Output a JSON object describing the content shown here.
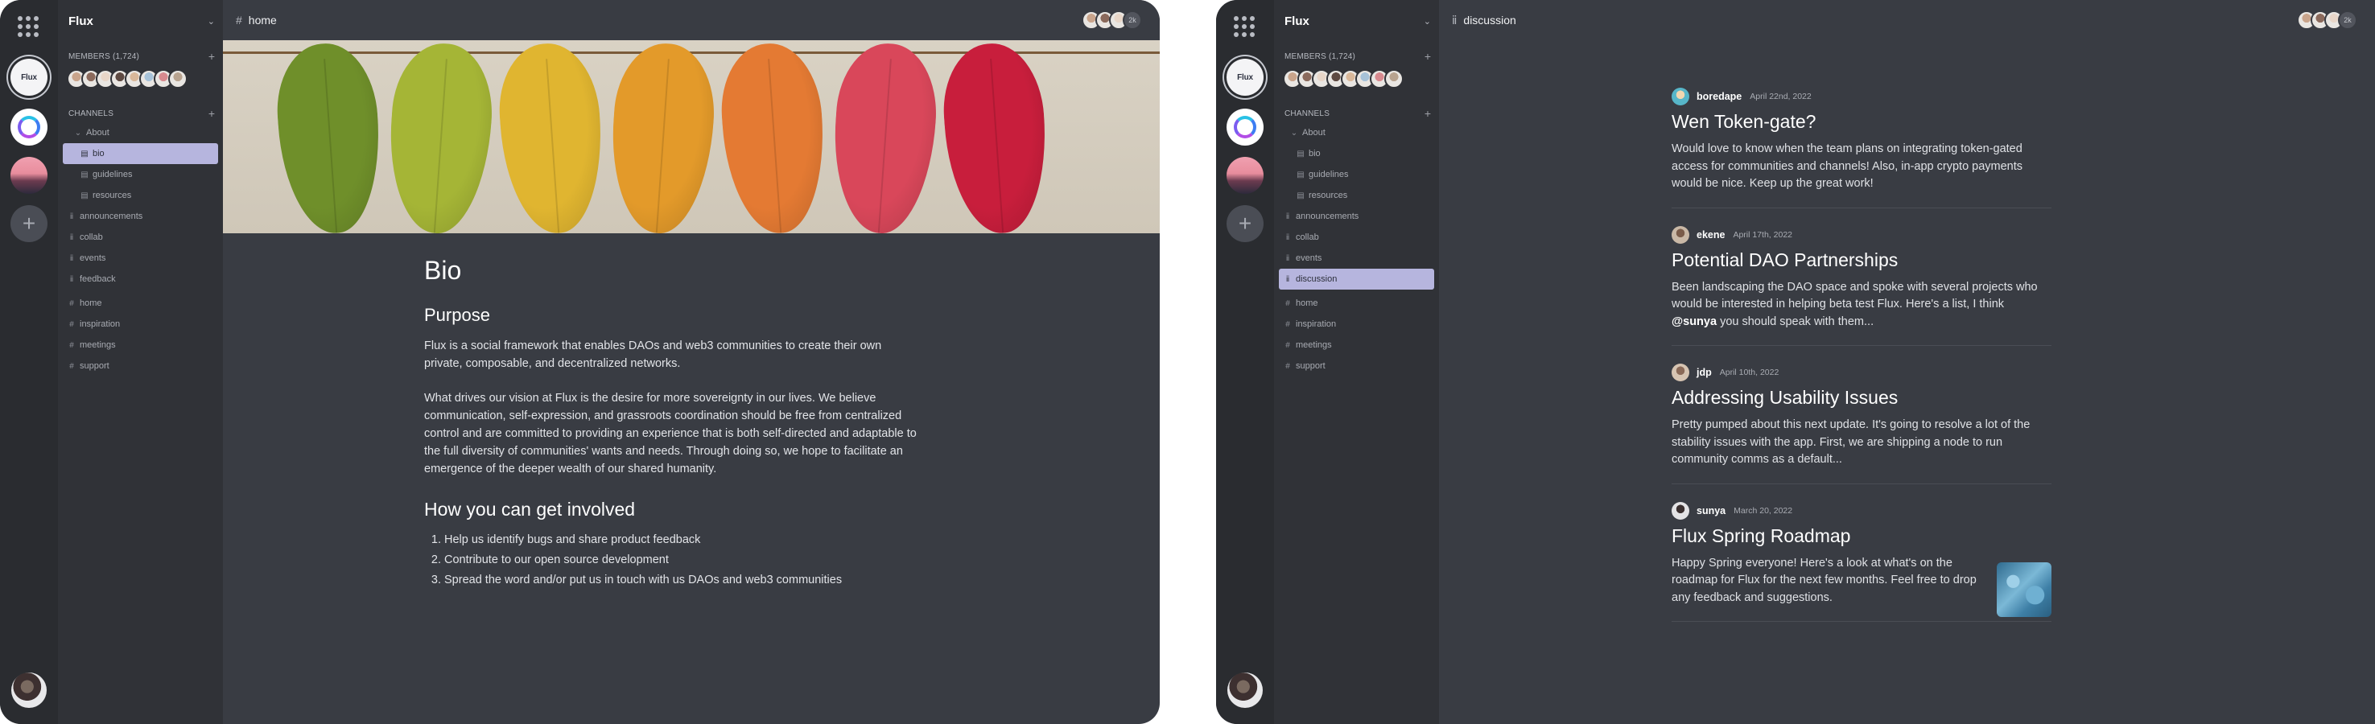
{
  "left": {
    "sidebar": {
      "community_name": "Flux",
      "members_label": "MEMBERS (1,724)",
      "channels_label": "CHANNELS",
      "channels": [
        {
          "label": "About",
          "glyph": "chevron-down-icon",
          "level": 1
        },
        {
          "label": "bio",
          "glyph": "page-icon",
          "level": 2,
          "active": true
        },
        {
          "label": "guidelines",
          "glyph": "page-icon",
          "level": 2
        },
        {
          "label": "resources",
          "glyph": "page-icon",
          "level": 2
        },
        {
          "label": "announcements",
          "glyph": "feed-icon",
          "level": 0
        },
        {
          "label": "collab",
          "glyph": "feed-icon",
          "level": 0
        },
        {
          "label": "events",
          "glyph": "feed-icon",
          "level": 0
        },
        {
          "label": "feedback",
          "glyph": "feed-icon",
          "level": 0
        },
        {
          "label": "home",
          "glyph": "hash-icon",
          "level": 0
        },
        {
          "label": "inspiration",
          "glyph": "hash-icon",
          "level": 0
        },
        {
          "label": "meetings",
          "glyph": "hash-icon",
          "level": 0
        },
        {
          "label": "support",
          "glyph": "hash-icon",
          "level": 0
        }
      ]
    },
    "header": {
      "title": "home",
      "more_count": "2k"
    },
    "document": {
      "title": "Bio",
      "purpose_heading": "Purpose",
      "paragraph_1": "Flux is a social framework that enables DAOs and web3 communities to create their own private, composable, and decentralized networks.",
      "paragraph_2": "What drives our vision at Flux is the desire for more sovereignty in our lives. We believe communication, self-expression, and grassroots coordination should be free from centralized control and are committed to providing an experience that is both self-directed and adaptable to the full diversity of communities' wants and needs. Through doing so, we hope to facilitate an emergence of the deeper wealth of our shared humanity.",
      "involved_heading": "How you can get involved",
      "steps": [
        "Help us identify bugs and share product feedback",
        "Contribute to our open source development",
        "Spread the word and/or put us in touch with us DAOs and web3 communities"
      ]
    }
  },
  "right": {
    "sidebar": {
      "community_name": "Flux",
      "members_label": "MEMBERS (1,724)",
      "channels_label": "CHANNELS",
      "channels": [
        {
          "label": "About",
          "glyph": "chevron-down-icon",
          "level": 1
        },
        {
          "label": "bio",
          "glyph": "page-icon",
          "level": 2
        },
        {
          "label": "guidelines",
          "glyph": "page-icon",
          "level": 2
        },
        {
          "label": "resources",
          "glyph": "page-icon",
          "level": 2
        },
        {
          "label": "announcements",
          "glyph": "feed-icon",
          "level": 0
        },
        {
          "label": "collab",
          "glyph": "feed-icon",
          "level": 0
        },
        {
          "label": "events",
          "glyph": "feed-icon",
          "level": 0
        },
        {
          "label": "discussion",
          "glyph": "feed-icon",
          "level": 0,
          "active": true
        },
        {
          "label": "home",
          "glyph": "hash-icon",
          "level": 0
        },
        {
          "label": "inspiration",
          "glyph": "hash-icon",
          "level": 0
        },
        {
          "label": "meetings",
          "glyph": "hash-icon",
          "level": 0
        },
        {
          "label": "support",
          "glyph": "hash-icon",
          "level": 0
        }
      ]
    },
    "header": {
      "title": "discussion",
      "more_count": "2k"
    },
    "posts": [
      {
        "author": "boredape",
        "date": "April 22nd, 2022",
        "title": "Wen Token-gate?",
        "excerpt": "Would love to know when the team plans on integrating token-gated access for communities and channels! Also, in-app crypto payments would be nice. Keep up the great work!"
      },
      {
        "author": "ekene",
        "date": "April 17th, 2022",
        "title": "Potential DAO Partnerships",
        "excerpt_before": "Been landscaping the DAO space and spoke with several projects who would be interested in helping beta test Flux. Here's a list, I think ",
        "mention": "@sunya",
        "excerpt_after": " you should speak with them..."
      },
      {
        "author": "jdp",
        "date": "April 10th, 2022",
        "title": "Addressing Usability Issues",
        "excerpt": "Pretty pumped about this next update. It's going to resolve a lot of the stability issues with the app. First, we are shipping a node to run community comms as a default..."
      },
      {
        "author": "sunya",
        "date": "March 20, 2022",
        "title": "Flux Spring Roadmap",
        "excerpt": "Happy Spring everyone! Here's a look at what's on the roadmap for Flux for the next few months. Feel free to drop any feedback and suggestions."
      }
    ]
  },
  "colors": {
    "rail": "#2a2c30",
    "sidebar": "#303237",
    "content": "#393c43",
    "active_channel": "#b6b5de",
    "leaves": [
      "#6f8f2a",
      "#a5b536",
      "#e0b530",
      "#e39a2a",
      "#e47a33",
      "#d9475a",
      "#c81e3c"
    ],
    "avatars": [
      "#c9a48b",
      "#8b6a5c",
      "#e8d6c8",
      "#5e4a42",
      "#d9b89a",
      "#a7c2d8",
      "#d88a8f",
      "#b8a38f"
    ]
  }
}
